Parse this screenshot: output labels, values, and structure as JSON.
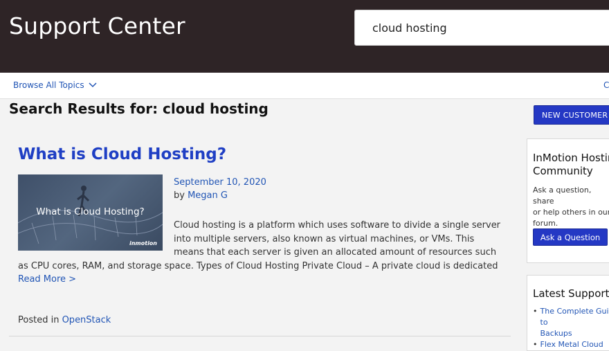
{
  "header": {
    "title": "Support Center",
    "search_value": "cloud hosting"
  },
  "subnav": {
    "browse_label": "Browse All Topics",
    "right_partial": "C"
  },
  "results": {
    "heading": "Search Results for: cloud hosting",
    "new_customer_label": "NEW CUSTOMER",
    "article": {
      "title": "What is Cloud Hosting?",
      "thumbnail_text": "What is Cloud Hosting?",
      "thumbnail_brand": "inmotion",
      "date": "September 10, 2020",
      "by_label": "by",
      "author": "Megan G",
      "excerpt": "Cloud hosting is a platform which uses software to divide a single server into multiple servers, also known as virtual machines, or VMs. This means that each server is given an allocated amount of resources such as CPU cores, RAM, and storage space. Types of Cloud Hosting Private Cloud – A private cloud is dedicated",
      "read_more": "Read More >",
      "posted_in_label": "Posted in",
      "category": "OpenStack"
    }
  },
  "sidebar": {
    "community": {
      "title": "InMotion Hosting\nCommunity",
      "description": "Ask a question, share\nor help others in our\nforum.",
      "button_label": "Ask a Question"
    },
    "latest": {
      "title": "Latest Support",
      "items": [
        {
          "label": "The Complete Guide to\nBackups"
        },
        {
          "label": "Flex Metal Cloud"
        }
      ]
    }
  }
}
